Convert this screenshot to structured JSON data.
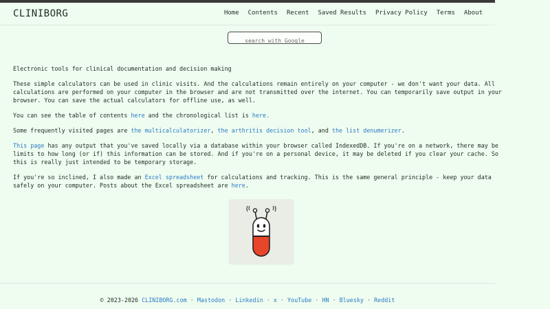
{
  "header": {
    "brand": "CLINIBORG",
    "nav": [
      {
        "label": "Home"
      },
      {
        "label": "Contents"
      },
      {
        "label": "Recent"
      },
      {
        "label": "Saved Results"
      },
      {
        "label": "Privacy Policy"
      },
      {
        "label": "Terms"
      },
      {
        "label": "About"
      }
    ]
  },
  "search": {
    "placeholder": "search with Google"
  },
  "content": {
    "intro": "Electronic tools for clinical documentation and decision making",
    "p1": "These simple calculators can be used in clinic visits. And the calculations remain entirely on your computer - we don't want your data. All calculations are performed on your computer in the browser and are not transmitted over the internet. You can temporarily save output in your browser. You can save the actual calculators for offline use, as well.",
    "p2": {
      "pre": "You can see the table of contents ",
      "link1": "here",
      "mid": " and the chronological list is ",
      "link2": "here.",
      "post": ""
    },
    "p3": {
      "pre": "Some frequently visited pages are ",
      "link1": "the multicalculatorizer",
      "sep1": ", ",
      "link2": "the arthritis decision tool",
      "sep2": ", and ",
      "link3": "the list denumerizer",
      "post": "."
    },
    "p4": {
      "link": "This page",
      "text": " has any output that you've saved locally via a database within your browser called IndexedDB. If you're on a network, there may be limits to how long (or if) this information can be stored. And if you're on a personal device, it may be deleted if you clear your cache. So this is really just intended to be temporary storage."
    },
    "p5": {
      "pre": "If you're so inclined, I also made an ",
      "link1": "Excel spreadsheet",
      "mid": " for calculations and tracking. This is the same general principle - keep your data safely on your computer. Posts about the Excel spreadsheet are ",
      "link2": "here",
      "post": "."
    }
  },
  "footer": {
    "copyright": "© 2023-2026 ",
    "site": "CLINIBORG.com",
    "links": [
      "Mastodon",
      "Linkedin",
      "x",
      "YouTube",
      "HN",
      "Bluesky",
      "Reddit"
    ],
    "separator": " · "
  },
  "colors": {
    "background": "#effdf0",
    "link": "#2a79c7",
    "pill_red": "#e8452a",
    "pill_white": "#ffffff"
  }
}
